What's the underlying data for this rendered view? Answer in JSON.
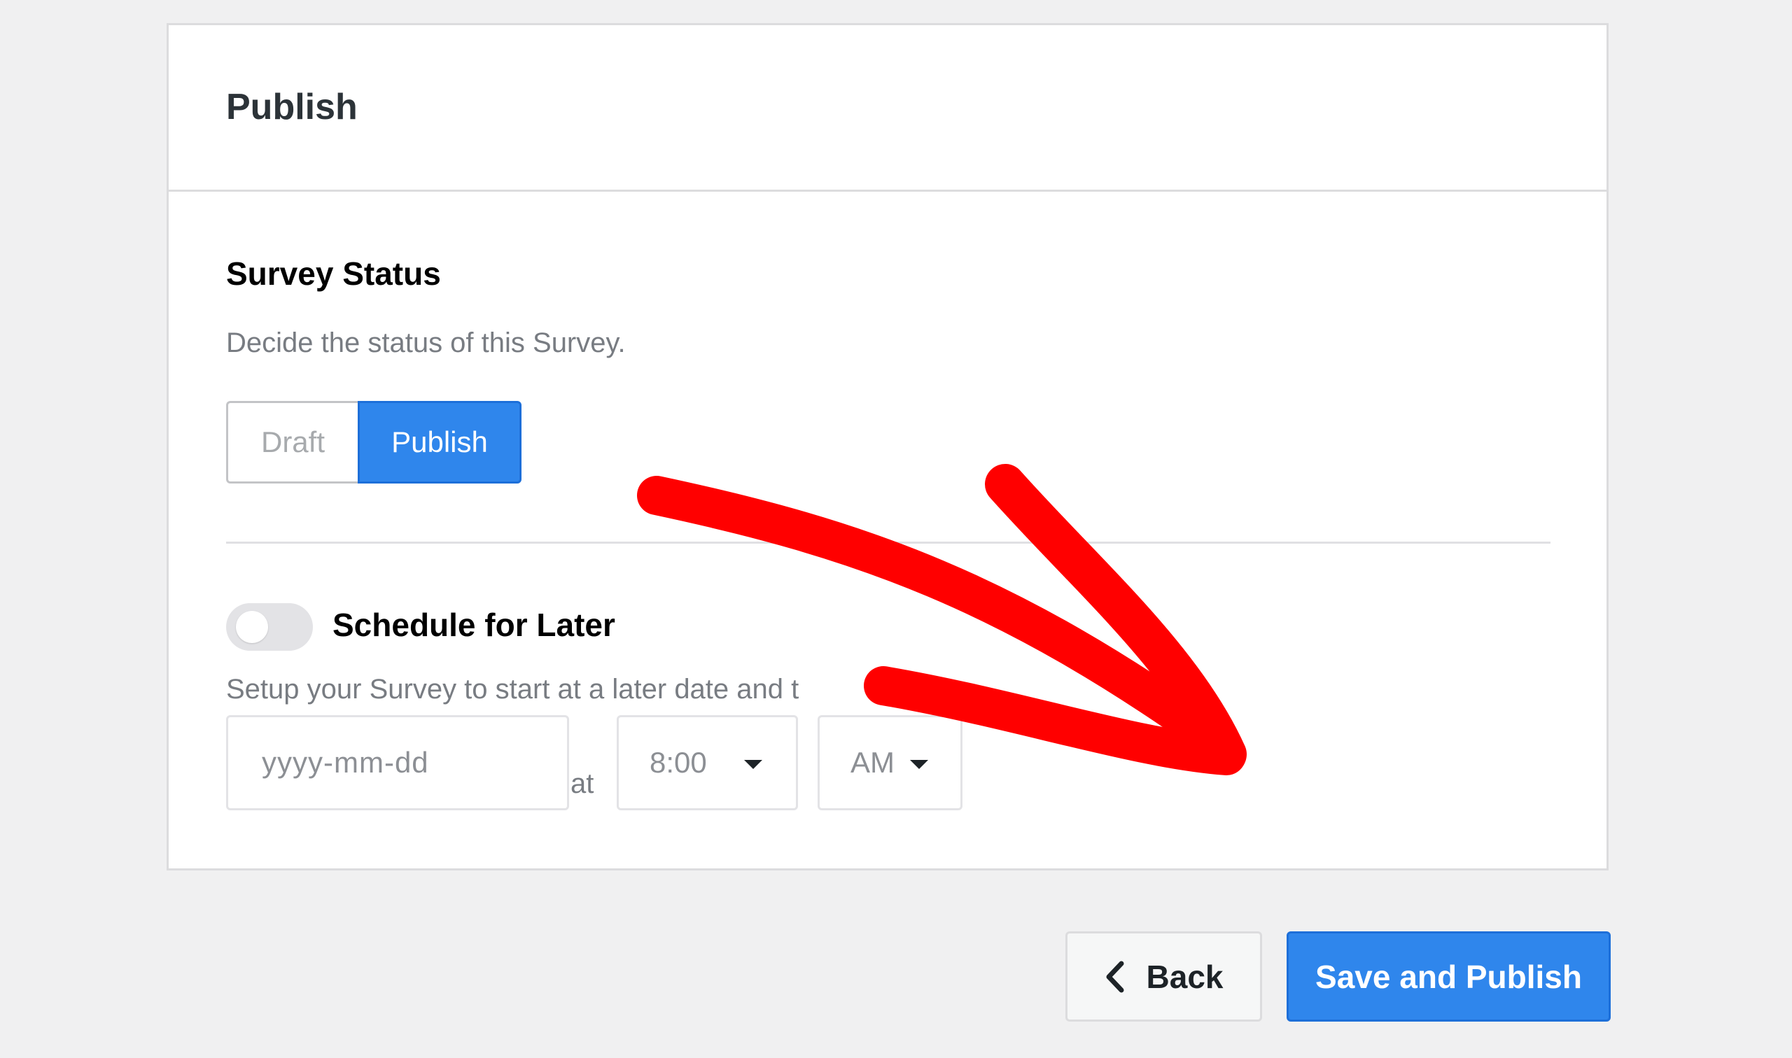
{
  "card": {
    "title": "Publish"
  },
  "survey_status": {
    "title": "Survey Status",
    "description": "Decide the status of this Survey.",
    "options": [
      "Draft",
      "Publish"
    ],
    "selected": "Publish"
  },
  "schedule": {
    "title": "Schedule for Later",
    "enabled": false,
    "description": "Setup your Survey to start at a later date and t",
    "date_placeholder": "yyyy-mm-dd",
    "at_label": "at",
    "time_value": "8:00",
    "period_value": "AM"
  },
  "footer": {
    "back_label": "Back",
    "save_label": "Save and Publish"
  },
  "colors": {
    "accent": "#2f86ec",
    "annotation_arrow": "#ff0000",
    "background": "#f0f0f1"
  },
  "icons": {
    "back": "chevron-left-icon",
    "dropdown": "caret-down-icon"
  }
}
